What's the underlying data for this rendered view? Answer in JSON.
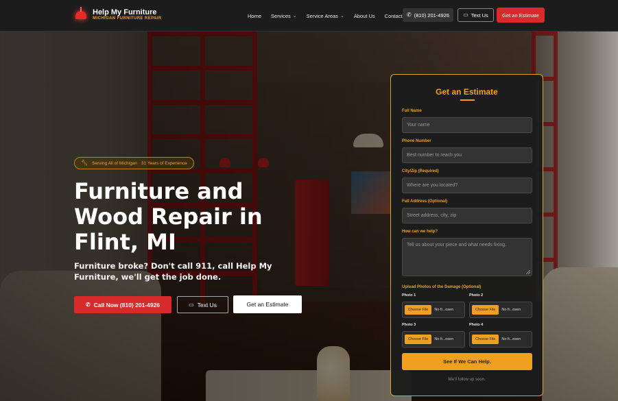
{
  "brand": {
    "name": "Help My Furniture",
    "tagline": "MICHIGAN FURNITURE REPAIR"
  },
  "nav": {
    "items": [
      {
        "label": "Home",
        "has_dropdown": false
      },
      {
        "label": "Services",
        "has_dropdown": true
      },
      {
        "label": "Service Areas",
        "has_dropdown": true
      },
      {
        "label": "About Us",
        "has_dropdown": false
      },
      {
        "label": "Contact",
        "has_dropdown": false
      }
    ],
    "phone_label": "(810) 201-4926",
    "text_label": "Text Us",
    "estimate_label": "Get an Estimate"
  },
  "hero": {
    "badge_left": "Serving All of Michigan",
    "badge_right": "31 Years of Experience",
    "title": "Furniture and Wood Repair in Flint, MI",
    "subtitle": "Furniture broke? Don't call 911, call Help My Furniture, we'll get the job done.",
    "call_label": "Call Now (810) 201-4926",
    "text_label": "Text Us",
    "estimate_label": "Get an Estimate"
  },
  "form": {
    "title": "Get an Estimate",
    "fields": {
      "full_name": {
        "label": "Full Name",
        "placeholder": "Your name",
        "value": ""
      },
      "phone": {
        "label": "Phone Number",
        "placeholder": "Best number to reach you",
        "value": ""
      },
      "city_zip": {
        "label": "City/Zip (Required)",
        "placeholder": "Where are you located?",
        "value": ""
      },
      "address": {
        "label": "Full Address (Optional)",
        "placeholder": "Street address, city, zip",
        "value": ""
      },
      "help": {
        "label": "How can we help?",
        "placeholder": "Tell us about your piece and what needs fixing.",
        "value": ""
      }
    },
    "photos_label": "Upload Photos of the Damage (Optional)",
    "photos": [
      {
        "label": "Photo 1",
        "button": "Choose File",
        "status": "No fi...osen"
      },
      {
        "label": "Photo 2",
        "button": "Choose File",
        "status": "No fi...osen"
      },
      {
        "label": "Photo 3",
        "button": "Choose File",
        "status": "No fi...osen"
      },
      {
        "label": "Photo 4",
        "button": "Choose File",
        "status": "No fi...osen"
      }
    ],
    "submit_label": "See If We Can Help.",
    "footnote": "We'll follow up soon."
  },
  "colors": {
    "accent_gold": "#f0a020",
    "accent_red": "#d72a2a",
    "header_bg": "#1c1c1c",
    "card_bg": "#1c1c1c"
  },
  "icons": {
    "phone": "phone-icon",
    "chat": "chat-icon",
    "wrench": "wrench-icon",
    "chevron": "chevron-down-icon"
  }
}
